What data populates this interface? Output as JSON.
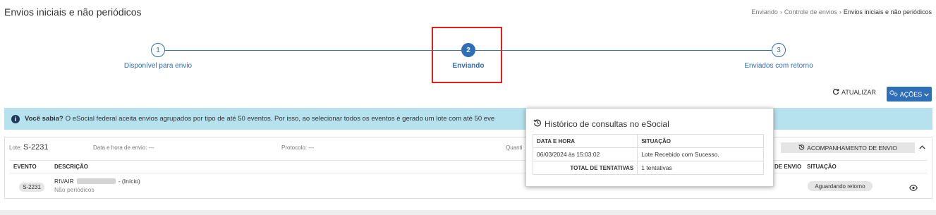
{
  "header": {
    "title": "Envios iniciais e não periódicos",
    "breadcrumb": [
      "Enviando",
      "Controle de envios",
      "Envios iniciais e não periódicos"
    ]
  },
  "stepper": {
    "steps": [
      {
        "number": "1",
        "label": "Disponível para envio",
        "active": false
      },
      {
        "number": "2",
        "label": "Enviando",
        "active": true
      },
      {
        "number": "3",
        "label": "Enviados com retorno",
        "active": false
      }
    ]
  },
  "toolbar": {
    "atualizar_label": "ATUALIZAR",
    "acoes_label": "AÇÕES"
  },
  "banner": {
    "bold": "Você sabia?",
    "text": "O eSocial federal aceita envios agrupados por tipo de até 50 eventos. Por isso, ao selecionar todos os eventos é gerado um lote com até 50 eve"
  },
  "lote": {
    "label": "Lote:",
    "number": "S-2231",
    "datetime_label": "Data e hora de envio: ---",
    "protocol_label": "Protocolo: ---",
    "quant_label": "Quanti",
    "acompanhamento_label": "ACOMPANHAMENTO DE ENVIO",
    "columns": {
      "evento": "EVENTO",
      "descricao": "DESCRIÇÃO",
      "data_envio_partial": "DE ENVIO",
      "situacao": "SITUAÇÃO"
    },
    "row": {
      "evento": "S-2231",
      "name": "RIVAIR",
      "suffix": "- (Início)",
      "sub": "Não periódicos",
      "situacao": "Aguardando retorno"
    }
  },
  "popover": {
    "title": "Histórico de consultas no eSocial",
    "headers": [
      "DATA E HORA",
      "SITUAÇÃO"
    ],
    "rows": [
      {
        "datetime": "06/03/2024 às 15:03:02",
        "status": "Lote Recebido com Sucesso."
      }
    ],
    "total_label": "TOTAL DE TENTATIVAS",
    "total_value": "1 tentativas"
  },
  "colors": {
    "primary": "#2e6fb7",
    "highlight": "#e0201b",
    "banner": "#b6e1ee"
  },
  "icons": [
    "refresh-icon",
    "gears-icon",
    "chevron-down-icon",
    "info-icon",
    "history-icon",
    "chevron-up-icon",
    "eye-icon"
  ]
}
